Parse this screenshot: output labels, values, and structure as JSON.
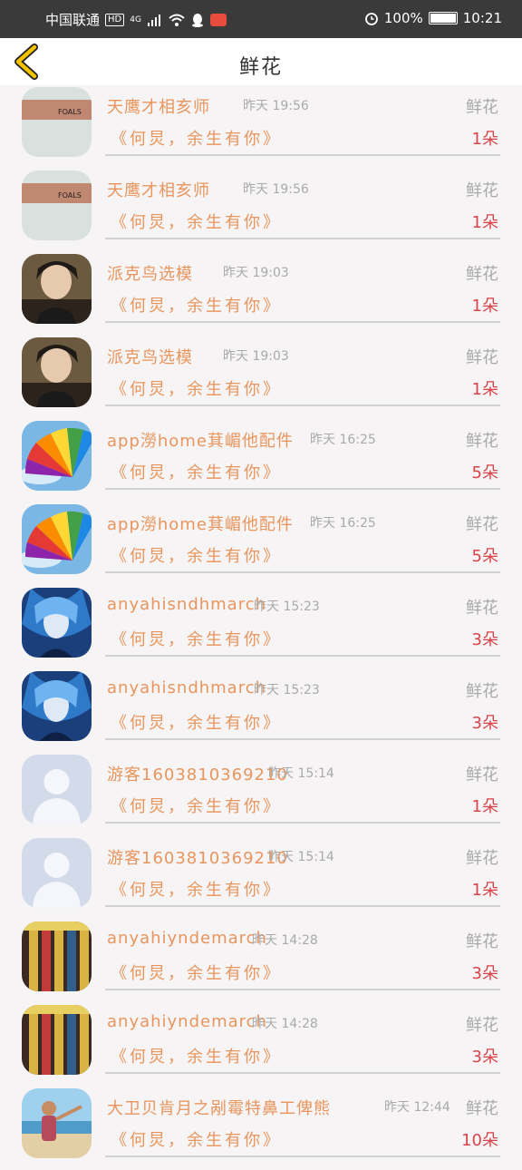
{
  "status_bar": {
    "carrier": "中国联通",
    "hd": "HD",
    "network": "4G",
    "battery": "100%",
    "time": "10:21"
  },
  "header": {
    "title": "鲜花"
  },
  "rows": [
    {
      "name": "天鹰才相亥师",
      "time": "昨天 19:56",
      "gift": "鲜花",
      "song": "《何炅，余生有你》",
      "count": "1朵",
      "avatar": "tattoo-arm"
    },
    {
      "name": "天鹰才相亥师",
      "time": "昨天 19:56",
      "gift": "鲜花",
      "song": "《何炅，余生有你》",
      "count": "1朵",
      "avatar": "tattoo-arm"
    },
    {
      "name": "派克鸟选模",
      "time": "昨天 19:03",
      "gift": "鲜花",
      "song": "《何炅，余生有你》",
      "count": "1朵",
      "avatar": "boy-photo"
    },
    {
      "name": "派克鸟选模",
      "time": "昨天 19:03",
      "gift": "鲜花",
      "song": "《何炅，余生有你》",
      "count": "1朵",
      "avatar": "boy-photo"
    },
    {
      "name": "app澇home萁嵋他配件",
      "time": "昨天 16:25",
      "gift": "鲜花",
      "song": "《何炅，余生有你》",
      "count": "5朵",
      "avatar": "rainbow-fan"
    },
    {
      "name": "app澇home萁嵋他配件",
      "time": "昨天 16:25",
      "gift": "鲜花",
      "song": "《何炅，余生有你》",
      "count": "5朵",
      "avatar": "rainbow-fan"
    },
    {
      "name": "anyahisndhmarch",
      "time": "昨天 15:23",
      "gift": "鲜花",
      "song": "《何炅，余生有你》",
      "count": "3朵",
      "avatar": "anime-blue"
    },
    {
      "name": "anyahisndhmarch",
      "time": "昨天 15:23",
      "gift": "鲜花",
      "song": "《何炅，余生有你》",
      "count": "3朵",
      "avatar": "anime-blue"
    },
    {
      "name": "游客1603810369210",
      "time": "昨天 15:14",
      "gift": "鲜花",
      "song": "《何炅，余生有你》",
      "count": "1朵",
      "avatar": "default-user"
    },
    {
      "name": "游客1603810369210",
      "time": "昨天 15:14",
      "gift": "鲜花",
      "song": "《何炅，余生有你》",
      "count": "1朵",
      "avatar": "default-user"
    },
    {
      "name": "anyahiyndemarch",
      "time": "昨天 14:28",
      "gift": "鲜花",
      "song": "《何炅，余生有你》",
      "count": "3朵",
      "avatar": "striped-items"
    },
    {
      "name": "anyahiyndemarch",
      "time": "昨天 14:28",
      "gift": "鲜花",
      "song": "《何炅，余生有你》",
      "count": "3朵",
      "avatar": "striped-items"
    },
    {
      "name": "大卫贝肯月之剐霉特鼻工俾熊",
      "time": "昨天 12:44",
      "gift": "鲜花",
      "song": "《何炅，余生有你》",
      "count": "10朵",
      "avatar": "beach-girl"
    }
  ]
}
